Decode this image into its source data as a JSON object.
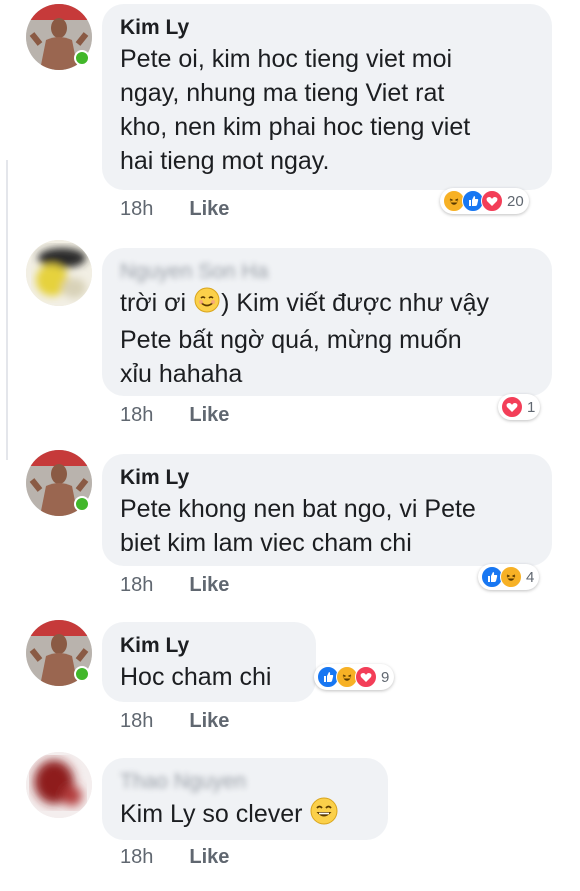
{
  "comments": [
    {
      "author": "Kim Ly",
      "text": "Pete oi, kim hoc tieng viet moi\nngay, nhung ma tieng Viet rat\nkho, nen kim phai hoc tieng viet\nhai tieng mot ngay.",
      "time": "18h",
      "like_label": "Like",
      "reactions": [
        "haha-icon",
        "like-icon",
        "love-icon"
      ],
      "reaction_count": "20"
    },
    {
      "author": "Nguyen Son Ha",
      "text_before_emoji": "trời ơi ",
      "text_after_emoji": ") Kim viết được như vậy\nPete bất ngờ quá, mừng muốn\nxỉu hahaha",
      "time": "18h",
      "like_label": "Like",
      "reactions": [
        "love-icon"
      ],
      "reaction_count": "1"
    },
    {
      "author": "Kim Ly",
      "text": "Pete khong nen bat ngo, vi Pete\nbiet kim lam viec cham chi",
      "time": "18h",
      "like_label": "Like",
      "reactions": [
        "like-icon",
        "haha-icon"
      ],
      "reaction_count": "4"
    },
    {
      "author": "Kim Ly",
      "text": "Hoc cham chi",
      "time": "18h",
      "like_label": "Like",
      "reactions": [
        "like-icon",
        "haha-icon",
        "love-icon"
      ],
      "reaction_count": "9"
    },
    {
      "author": "Thao Nguyen",
      "text": "Kim Ly so clever",
      "time": "18h",
      "like_label": "Like",
      "trailing_emoji": "laughing-emoji"
    }
  ],
  "colors": {
    "bubble": "#f0f2f5",
    "like": "#1877f2",
    "love": "#f33e58",
    "haha": "#f7b125",
    "online": "#42b72a"
  }
}
